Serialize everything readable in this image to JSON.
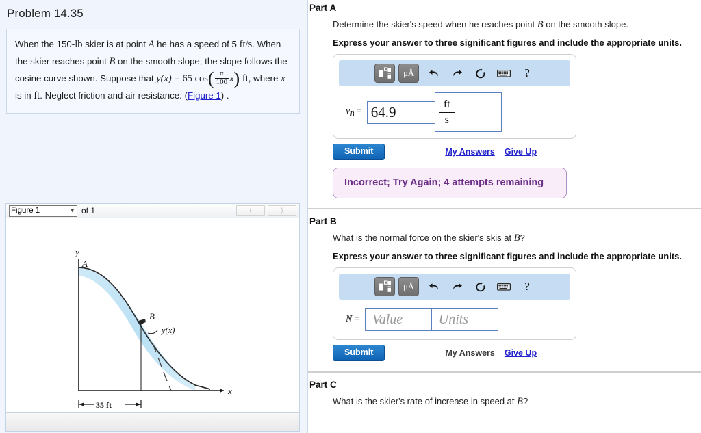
{
  "problem": {
    "title": "Problem 14.35",
    "statement_parts": {
      "s1": "When the 150-",
      "lb": "lb",
      "s2": " skier is at point ",
      "A": "A",
      "s3": " he has a speed of 5 ",
      "fts": "ft/s",
      "s4": ". When the skier reaches point ",
      "B": "B",
      "s5": " on the smooth slope, the slope follows the cosine curve shown. Suppose that ",
      "yx": "y(x)",
      "eq": "=",
      "n65": "65",
      "cos": "cos",
      "pi": "π",
      "d100": "100",
      "x": "x",
      "ft": "ft",
      "s6": ", where ",
      "x2": "x",
      "s7": " is in ",
      "ft2": "ft",
      "s8": ". Neglect friction and air resistance. (",
      "link": "Figure 1",
      "s9": ") ."
    }
  },
  "figure": {
    "selected": "Figure 1",
    "of_label": "of 1",
    "prev_icon": "chevron-left-icon",
    "next_icon": "chevron-right-icon",
    "labels": {
      "y_axis": "y",
      "x_axis": "x",
      "point_a": "A",
      "point_b": "B",
      "curve": "y(x)",
      "dimension": "35 ft"
    },
    "colors": {
      "snow": "#bfe3f5",
      "curve": "#333333"
    }
  },
  "mathbar": {
    "template_icon": "math-template-icon",
    "units_label": "μÅ",
    "undo_icon": "undo-icon",
    "redo_icon": "redo-icon",
    "reset_icon": "reset-icon",
    "keyboard_icon": "keyboard-icon",
    "help_label": "?"
  },
  "parts": {
    "a": {
      "heading": "Part A",
      "question_pre": "Determine the skier's speed when he reaches point ",
      "question_var": "B",
      "question_post": " on the smooth slope.",
      "instruction": "Express your answer to three significant figures and include the appropriate units.",
      "answer_label_var": "v",
      "answer_label_sub": "B",
      "answer_label_eq": " =",
      "answer_value": "64.9",
      "unit_numerator": "ft",
      "unit_denominator": "s",
      "submit_label": "Submit",
      "my_answers_label": "My Answers",
      "give_up_label": "Give Up",
      "alert_text": "Incorrect; Try Again; 4 attempts remaining"
    },
    "b": {
      "heading": "Part B",
      "question_pre": "What is the normal force on the skier's skis at ",
      "question_var": "B",
      "question_post": "?",
      "instruction": "Express your answer to three significant figures and include the appropriate units.",
      "answer_label_var": "N",
      "answer_label_eq": " =",
      "value_placeholder": "Value",
      "units_placeholder": "Units",
      "submit_label": "Submit",
      "my_answers_label": "My Answers",
      "give_up_label": "Give Up"
    },
    "c": {
      "heading": "Part C",
      "question_pre": "What is the skier's rate of increase in speed at ",
      "question_var": "B",
      "question_post": "?"
    }
  },
  "colors": {
    "accent_blue": "#0f63b4",
    "link_blue": "#2222cc",
    "mathbar_bg": "#c5dcf2",
    "alert_bg": "#f8edf8",
    "alert_text": "#6b2d86",
    "left_bg": "#f0f5fd"
  }
}
